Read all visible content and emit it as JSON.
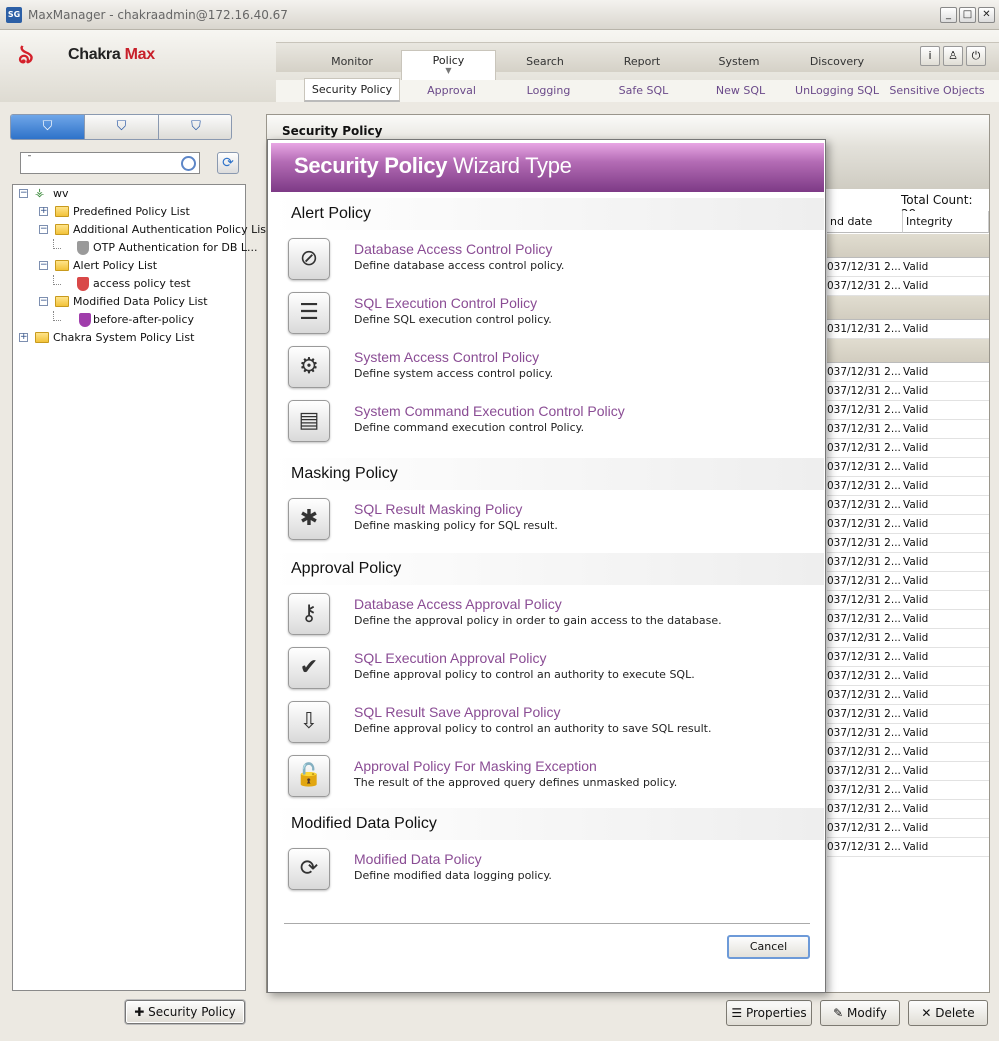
{
  "window": {
    "title": "MaxManager - chakraadmin@172.16.40.67",
    "app_icon": "SG",
    "min": "_",
    "max": "□",
    "close": "✕"
  },
  "header": {
    "logo_brand": "Chakra",
    "logo_brand2": "Max",
    "tabs": [
      "Monitor",
      "Policy",
      "Search",
      "Report",
      "System",
      "Discovery"
    ],
    "active_tab": "Policy",
    "icons": {
      "info": "i",
      "user": "♙",
      "exit": "⏻"
    }
  },
  "subnav": [
    "Security Policy",
    "Approval",
    "Logging",
    "Safe SQL",
    "New SQL",
    "UnLogging SQL",
    "Sensitive Objects"
  ],
  "left": {
    "search_value": "¯",
    "tree": [
      {
        "label": "wv",
        "level": 0
      },
      {
        "label": "Predefined Policy List",
        "level": 1
      },
      {
        "label": "Additional Authentication Policy List",
        "level": 1
      },
      {
        "label": "OTP Authentication for DB L...",
        "level": 2
      },
      {
        "label": "Alert Policy List",
        "level": 1
      },
      {
        "label": "access policy test",
        "level": 2
      },
      {
        "label": "Modified Data Policy List",
        "level": 1
      },
      {
        "label": "before-after-policy",
        "level": 2
      },
      {
        "label": "Chakra System Policy List",
        "level": 0
      }
    ],
    "add_button": "Security Policy"
  },
  "main": {
    "title": "Security Policy",
    "total_count": "Total Count: 29",
    "columns": [
      "nd date",
      "Integrity"
    ],
    "row_date": "037/12/31 2...",
    "row_date_alt": "031/12/31 2...",
    "row_status": "Valid"
  },
  "dialog": {
    "title_bold": "Security Policy",
    "title_rest": " Wizard Type",
    "sections": [
      {
        "label": "Alert Policy",
        "items": [
          {
            "title": "Database Access Control Policy",
            "desc": "Define database access control policy.",
            "icon": "⊘"
          },
          {
            "title": "SQL Execution Control Policy",
            "desc": "Define SQL execution control policy.",
            "icon": "☰"
          },
          {
            "title": "System Access Control Policy",
            "desc": "Define system access control policy.",
            "icon": "⚙"
          },
          {
            "title": "System Command Execution Control Policy",
            "desc": "Define command execution control Policy.",
            "icon": "▤"
          }
        ]
      },
      {
        "label": "Masking Policy",
        "items": [
          {
            "title": "SQL Result Masking Policy",
            "desc": "Define masking policy for SQL result.",
            "icon": "✱"
          }
        ]
      },
      {
        "label": "Approval Policy",
        "items": [
          {
            "title": "Database Access Approval Policy",
            "desc": "Define the approval policy in order to gain access to the database.",
            "icon": "⚷"
          },
          {
            "title": "SQL Execution Approval Policy",
            "desc": "Define approval policy to control an authority to execute SQL.",
            "icon": "✔"
          },
          {
            "title": "SQL Result Save Approval Policy",
            "desc": "Define approval policy to control an authority to save SQL result.",
            "icon": "⇩"
          },
          {
            "title": "Approval Policy For Masking Exception",
            "desc": "The result of the approved query defines unmasked policy.",
            "icon": "🔓"
          }
        ]
      },
      {
        "label": "Modified Data Policy",
        "items": [
          {
            "title": "Modified Data Policy",
            "desc": "Define modified data logging policy.",
            "icon": "⟳"
          }
        ]
      }
    ],
    "cancel": "Cancel"
  },
  "bottom": {
    "properties": "Properties",
    "modify": "Modify",
    "delete": "Delete"
  },
  "colors": {
    "accent_purple": "#8a4c94",
    "header_purple": "#7d3a86",
    "brand_red": "#d4202a"
  }
}
